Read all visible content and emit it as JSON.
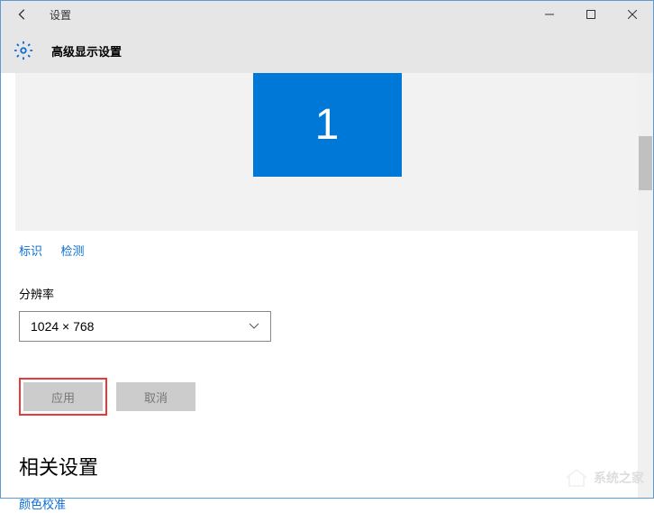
{
  "titlebar": {
    "title": "设置"
  },
  "header": {
    "page_title": "高级显示设置"
  },
  "monitor": {
    "number": "1"
  },
  "links": {
    "identify": "标识",
    "detect": "检测"
  },
  "resolution": {
    "label": "分辨率",
    "value": "1024 × 768"
  },
  "buttons": {
    "apply": "应用",
    "cancel": "取消"
  },
  "related": {
    "heading": "相关设置",
    "color_calibration": "颜色校准"
  },
  "watermark": {
    "text": "系统之家"
  }
}
